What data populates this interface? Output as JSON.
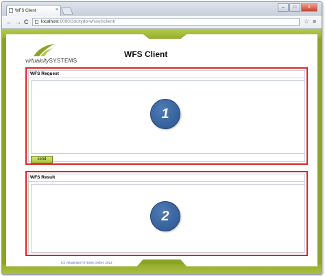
{
  "browser": {
    "tab_title": "WFS Client",
    "tab_close": "×",
    "url_host": "localhost",
    "url_path": ":8080/3dcitydb-wfs/wfsclient/",
    "nav_back": "←",
    "nav_forward": "→",
    "nav_reload": "C",
    "bookmark_star": "☆",
    "menu": "≡",
    "win_minimize": "–",
    "win_maximize": "□",
    "win_close": "x"
  },
  "header": {
    "logo_text_lower": "virtualcity",
    "logo_text_caps": "SYSTEMS",
    "title": "WFS Client"
  },
  "request_panel": {
    "title": "WFS Request",
    "send_label": "send",
    "badge": "1"
  },
  "result_panel": {
    "title": "WFS Result",
    "badge": "2"
  },
  "footer": {
    "copyright": "(C) virtualcitySYSTEMS GmbH, 2013"
  },
  "colors": {
    "accent_olive": "#8ba428",
    "highlight_red": "#e02222",
    "badge_blue": "#2a5591",
    "footer_link": "#3b55b8"
  }
}
